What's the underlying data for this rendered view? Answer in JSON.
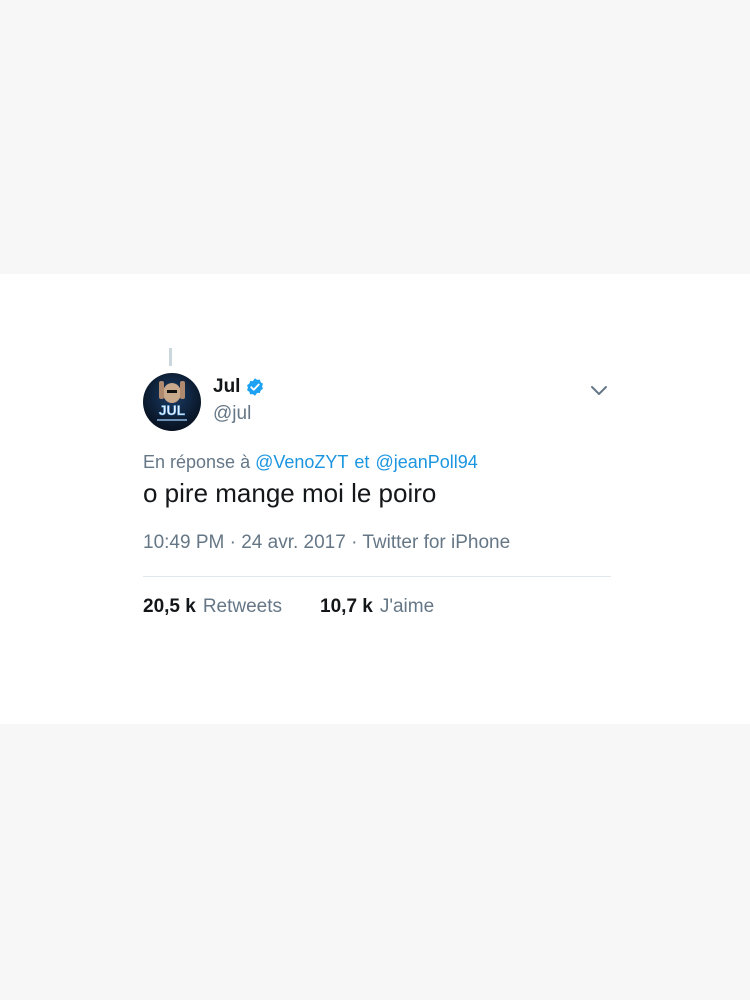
{
  "tweet": {
    "author": {
      "display_name": "Jul",
      "handle": "@jul",
      "verified": true,
      "verified_color": "#1da1f2",
      "avatar_text": "JUL"
    },
    "reply": {
      "prefix": "En réponse à",
      "mention_1": "@VenoZYT",
      "conjunction": "et",
      "mention_2": "@jeanPoll94"
    },
    "text": "o pire mange moi le poiro",
    "meta": "10:49 PM · 24 avr. 2017 · Twitter for iPhone",
    "stats": {
      "retweets_count": "20,5 k",
      "retweets_label": "Retweets",
      "likes_count": "10,7 k",
      "likes_label": "J'aime"
    },
    "menu_icon": "chevron-down-icon"
  }
}
